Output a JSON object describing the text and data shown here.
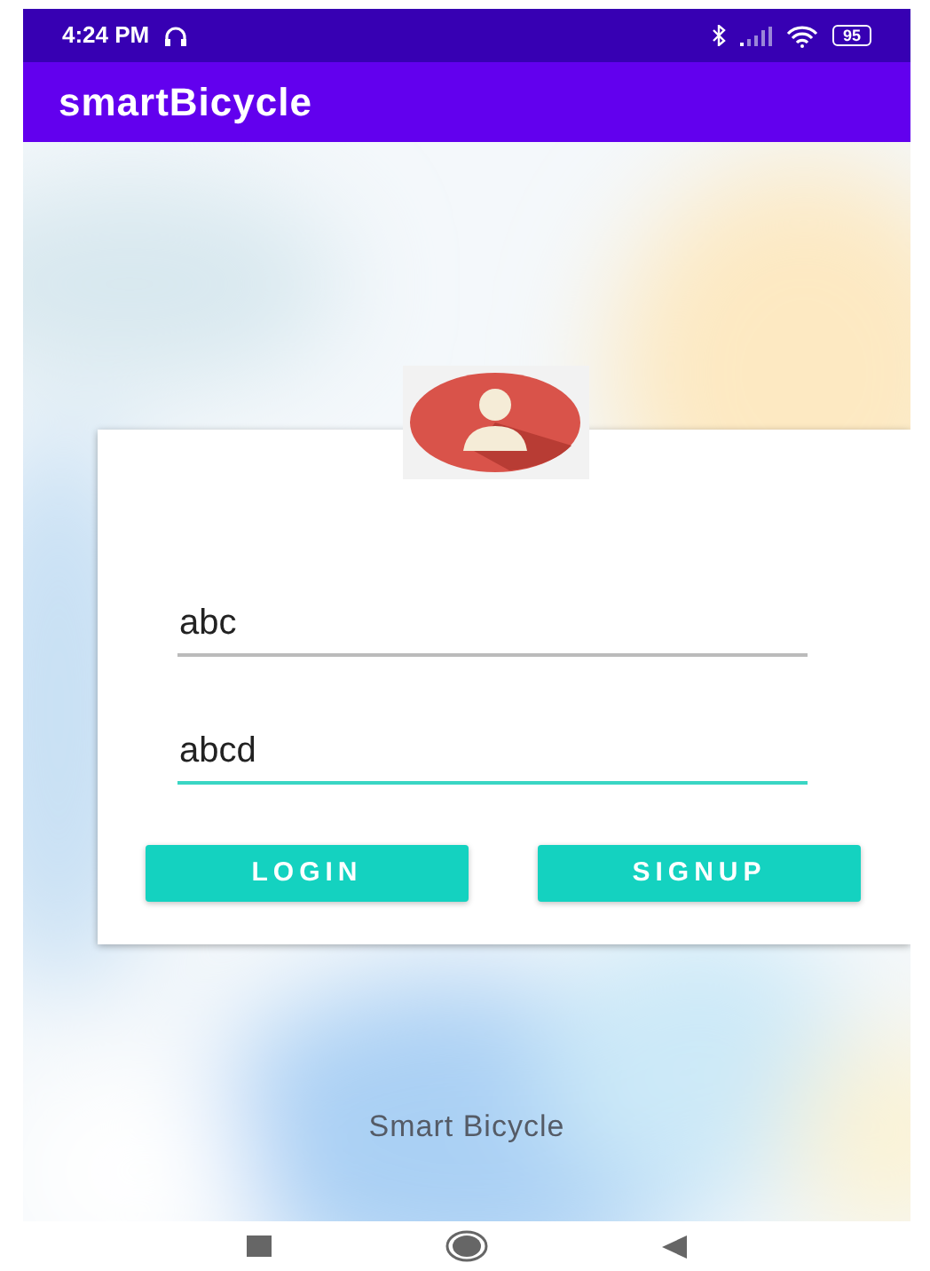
{
  "status_bar": {
    "time": "4:24 PM",
    "battery": "95"
  },
  "app_bar": {
    "title": "smartBicycle"
  },
  "fields": [
    {
      "value": "abc",
      "focused": false
    },
    {
      "value": "abcd",
      "focused": true
    }
  ],
  "buttons": [
    "LOGIN",
    "SIGNUP"
  ],
  "footer": "Smart Bicycle"
}
